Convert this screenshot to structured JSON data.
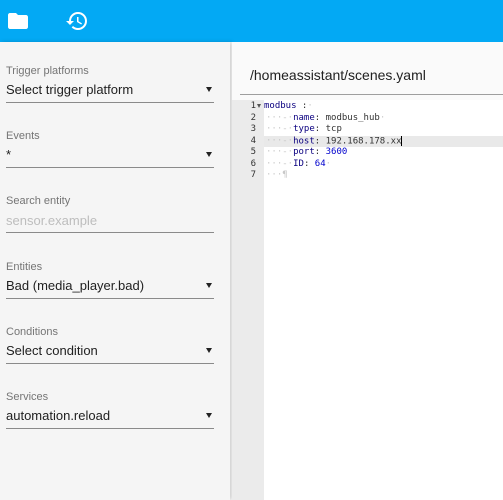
{
  "toolbar": {
    "folder_icon": "folder-icon",
    "history_icon": "history-icon",
    "color": "#03a9f4"
  },
  "sidebar": {
    "trigger": {
      "label": "Trigger platforms",
      "value": "Select trigger platform"
    },
    "events": {
      "label": "Events",
      "value": "*"
    },
    "search": {
      "label": "Search entity",
      "placeholder": "sensor.example",
      "value": ""
    },
    "entities": {
      "label": "Entities",
      "value": "Bad (media_player.bad)"
    },
    "conditions": {
      "label": "Conditions",
      "value": "Select condition"
    },
    "services": {
      "label": "Services",
      "value": "automation.reload"
    }
  },
  "editor": {
    "file_path": "/homeassistant/scenes.yaml",
    "active_line": 4,
    "lines": [
      {
        "number": "1",
        "key": "modbus",
        "sep": " :",
        "value": ""
      },
      {
        "number": "2",
        "key": "name",
        "sep": ": ",
        "value": "modbus_hub"
      },
      {
        "number": "3",
        "key": "type",
        "sep": ": ",
        "value": "tcp"
      },
      {
        "number": "4",
        "key": "host",
        "sep": ": ",
        "value": "192.168.178.xx"
      },
      {
        "number": "5",
        "key": "port",
        "sep": ": ",
        "value": "3600"
      },
      {
        "number": "6",
        "key": "ID",
        "sep": ": ",
        "value": "64"
      },
      {
        "number": "7",
        "key": "",
        "sep": "",
        "value": ""
      }
    ]
  }
}
